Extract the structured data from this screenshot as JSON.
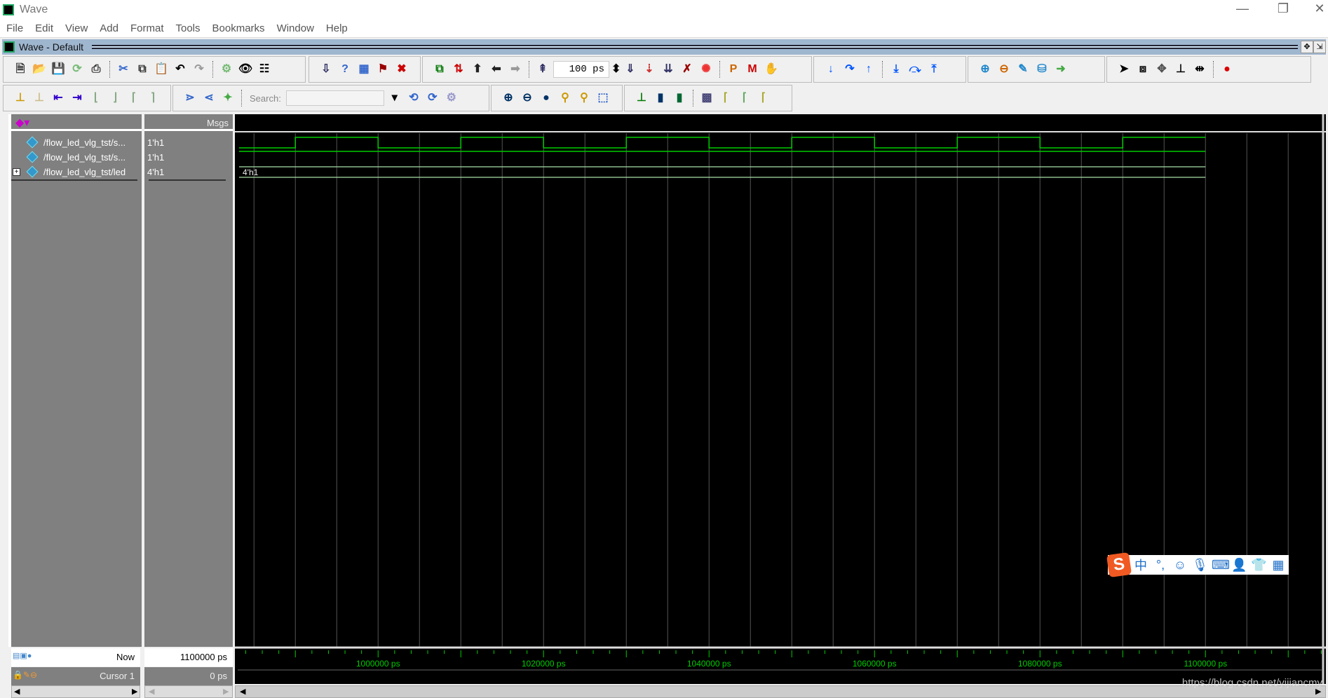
{
  "window": {
    "title": "Wave",
    "controls": [
      "—",
      "❐",
      "✕"
    ]
  },
  "menu": [
    "File",
    "Edit",
    "View",
    "Add",
    "Format",
    "Tools",
    "Bookmarks",
    "Window",
    "Help"
  ],
  "subwindow": {
    "title": "Wave - Default"
  },
  "toolbar1": {
    "groups": [
      [
        [
          "new-icon",
          "🗎",
          "#333"
        ],
        [
          "open-icon",
          "📂",
          "#c90"
        ],
        [
          "save-icon",
          "💾",
          "#660"
        ],
        [
          "reload-icon",
          "⟳",
          "#7b7"
        ],
        [
          "print-icon",
          "⎙",
          "#333"
        ],
        "|",
        [
          "cut-icon",
          "✂",
          "#36c"
        ],
        [
          "copy-icon",
          "⧉",
          "#333"
        ],
        [
          "paste-icon",
          "📋",
          "#663"
        ],
        [
          "undo-icon",
          "↶",
          "#000"
        ],
        [
          "redo-icon",
          "↷",
          "#999"
        ],
        "|",
        [
          "find-gear-icon",
          "⚙",
          "#7b7"
        ],
        [
          "binoculars-icon",
          "👁",
          "#000"
        ],
        [
          "structure-icon",
          "☷",
          "#000"
        ]
      ],
      [
        [
          "compile-icon",
          "⇩",
          "#336"
        ],
        [
          "help-icon",
          "?",
          "#36c"
        ],
        [
          "grid-icon",
          "▦",
          "#36c"
        ],
        [
          "simulate-icon",
          "⚑",
          "#900"
        ],
        [
          "break-icon",
          "✖",
          "#c00"
        ]
      ],
      [
        [
          "link-icon",
          "⧉",
          "#070"
        ],
        [
          "sort-icon",
          "⇅",
          "#c00"
        ],
        [
          "up-icon",
          "⬆",
          "#222"
        ],
        [
          "back-icon",
          "⬅",
          "#222"
        ],
        [
          "forward-icon",
          "➡",
          "#999"
        ],
        "|",
        [
          "run-length-icon",
          "⇞",
          "#336"
        ],
        "TIMEBOX",
        [
          "run-icon",
          "⇓",
          "#336"
        ],
        [
          "continue-icon",
          "⇣",
          "#c33"
        ],
        [
          "run-all-icon",
          "⇊",
          "#336"
        ],
        [
          "break-run-icon",
          "✗",
          "#900"
        ],
        [
          "stop-icon",
          "✺",
          "#e33"
        ],
        "|",
        [
          "profile-p-icon",
          "P",
          "#c60"
        ],
        [
          "profile-m-icon",
          "M",
          "#c00"
        ],
        [
          "hand-icon",
          "✋",
          "#333"
        ]
      ],
      [
        [
          "step-into-icon",
          "↓",
          "#05f"
        ],
        [
          "step-over-icon",
          "↷",
          "#05f"
        ],
        [
          "step-out-icon",
          "↑",
          "#05f"
        ],
        "|",
        [
          "step-into-all-icon",
          "⤓",
          "#05f"
        ],
        [
          "step-over-all-icon",
          "⤼",
          "#05f"
        ],
        [
          "step-out-all-icon",
          "⤒",
          "#05f"
        ]
      ],
      [
        [
          "add-dataflow-icon",
          "⊕",
          "#28c"
        ],
        [
          "remove-dataflow-icon",
          "⊖",
          "#c60"
        ],
        [
          "edit-dataflow-icon",
          "✎",
          "#28c"
        ],
        [
          "save-dataflow-icon",
          "⛁",
          "#28c"
        ],
        [
          "export-dataflow-icon",
          "➜",
          "#4a4"
        ]
      ],
      [
        [
          "select-mode-icon",
          "➤",
          "#000"
        ],
        [
          "zoom-mode-icon",
          "⧈",
          "#000"
        ],
        [
          "pan-mode-icon",
          "✥",
          "#555"
        ],
        [
          "edit-mode-icon",
          "⊥",
          "#000"
        ],
        [
          "split-icon",
          "⇹",
          "#000"
        ],
        "|",
        [
          "traffic-light-icon",
          "●",
          "#d00"
        ]
      ]
    ],
    "time_value": "100 ps"
  },
  "toolbar2": {
    "groups": [
      [
        [
          "insert-cursor-icon",
          "⊥",
          "#c90"
        ],
        [
          "delete-cursor-icon",
          "⊥",
          "#cb8"
        ],
        [
          "prev-cursor-icon",
          "⇤",
          "#30c"
        ],
        [
          "next-cursor-icon",
          "⇥",
          "#30c"
        ],
        [
          "prev-edge-icon",
          "⌊",
          "#8a8"
        ],
        [
          "next-edge-icon",
          "⌋",
          "#8a8"
        ],
        [
          "prev-fall-icon",
          "⌈",
          "#8a8"
        ],
        [
          "next-rise-icon",
          "⌉",
          "#8a8"
        ]
      ],
      [
        [
          "expand-icon",
          "⋗",
          "#36c"
        ],
        [
          "collapse-icon",
          "⋖",
          "#36c"
        ],
        [
          "select-tree-icon",
          "✦",
          "#4a4"
        ],
        "|",
        "SEARCH",
        [
          "search-prev-icon",
          "⟲",
          "#36c"
        ],
        [
          "search-next-icon",
          "⟳",
          "#36c"
        ],
        [
          "search-options-icon",
          "⚙",
          "#99c"
        ]
      ],
      [
        [
          "zoom-in-icon",
          "⊕",
          "#036"
        ],
        [
          "zoom-out-icon",
          "⊖",
          "#036"
        ],
        [
          "zoom-full-icon",
          "●",
          "#036"
        ],
        [
          "zoom-cursor-icon",
          "⚲",
          "#c90"
        ],
        [
          "zoom-between-icon",
          "⚲",
          "#c90"
        ],
        [
          "zoom-region-icon",
          "⬚",
          "#36c"
        ]
      ],
      [
        [
          "wave-line-icon",
          "⊥",
          "#070"
        ],
        [
          "wave-pulse-icon",
          "▮",
          "#036"
        ],
        [
          "wave-block-icon",
          "▮",
          "#063"
        ],
        "|",
        [
          "dither-icon",
          "▩",
          "#447"
        ],
        [
          "edge-a-icon",
          "⌈",
          "#aa3"
        ],
        [
          "edge-b-icon",
          "⌈",
          "#6a6"
        ],
        [
          "edge-c-icon",
          "⌈",
          "#aa3"
        ]
      ]
    ],
    "search_label": "Search:"
  },
  "panes": {
    "msgs_header": "Msgs"
  },
  "signals": [
    {
      "name": "/flow_led_vlg_tst/s...",
      "value": "1'h1",
      "expandable": false
    },
    {
      "name": "/flow_led_vlg_tst/s...",
      "value": "1'h1",
      "expandable": false
    },
    {
      "name": "/flow_led_vlg_tst/led",
      "value": "4'h1",
      "expandable": true,
      "expand_symbol": "+"
    }
  ],
  "waveform": {
    "unit": "ps",
    "view_start": 983200,
    "sim_end": 1100000,
    "grid_step": 5000,
    "minor_tick_step": 2000,
    "major_tick_step": 10000,
    "signal1_transitions": [
      [
        983200,
        0
      ],
      [
        990000,
        1
      ],
      [
        1000000,
        0
      ],
      [
        1010000,
        1
      ],
      [
        1020000,
        0
      ],
      [
        1030000,
        1
      ],
      [
        1040000,
        0
      ],
      [
        1050000,
        1
      ],
      [
        1060000,
        0
      ],
      [
        1070000,
        1
      ],
      [
        1080000,
        0
      ],
      [
        1090000,
        1
      ]
    ],
    "signal2_constant": 1,
    "bus_value": "4'h1",
    "wave_color": "#00cc00",
    "bus_color": "#a8e0a8"
  },
  "timeline_labels": [
    "1000000 ps",
    "1020000 ps",
    "1040000 ps",
    "1060000 ps",
    "1080000 ps",
    "1100000 ps"
  ],
  "timeline_values": [
    1000000,
    1020000,
    1040000,
    1060000,
    1080000,
    1100000
  ],
  "cursors": {
    "now_label": "Now",
    "now_value": "1100000 ps",
    "cursor_label": "Cursor 1",
    "cursor_value": "0 ps"
  },
  "ime": {
    "chars": [
      "中",
      "°,",
      "☺",
      "🎙",
      "⌨",
      "👤",
      "👕",
      "▦"
    ]
  },
  "watermark": "https://blog.csdn.net/yijiancmy"
}
